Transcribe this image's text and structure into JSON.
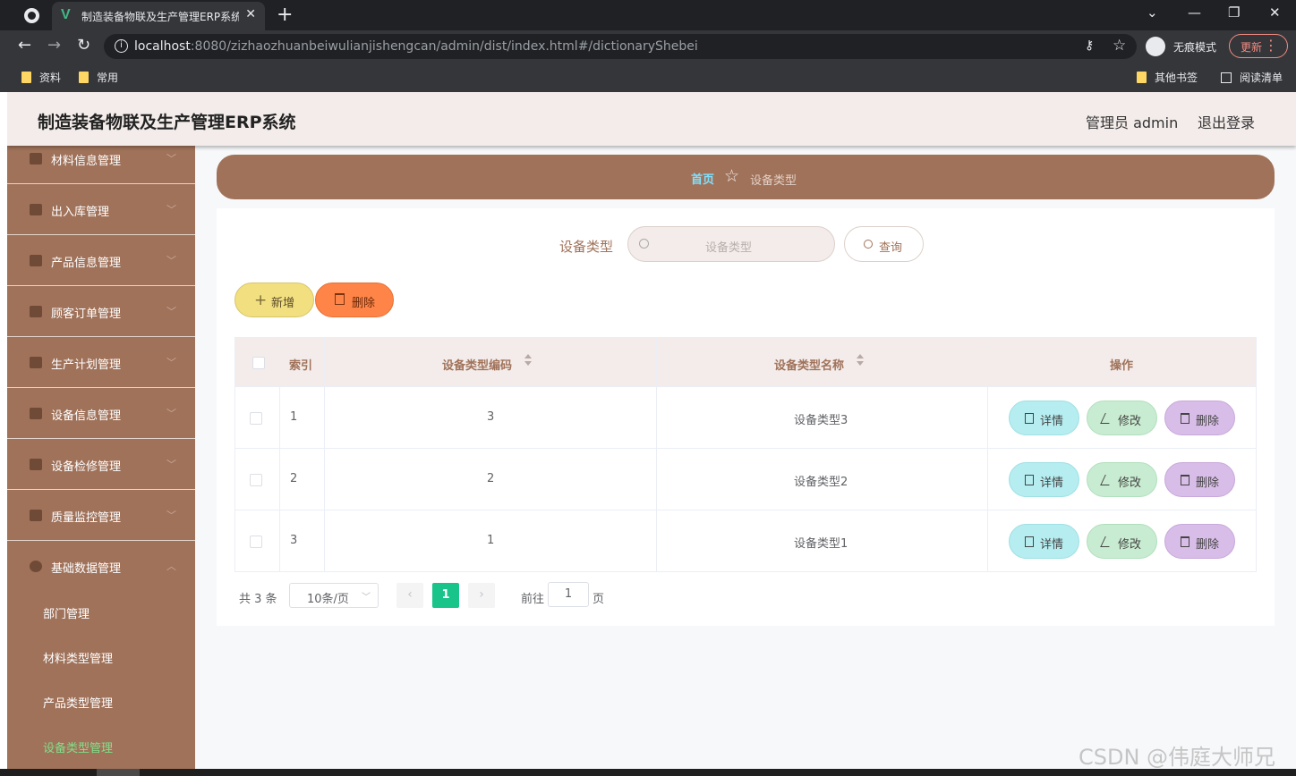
{
  "browser": {
    "tab_title": "制造装备物联及生产管理ERP系统",
    "close_glyph": "✕",
    "new_tab_glyph": "+",
    "url_host": "localhost",
    "url_rest": ":8080/zizhaozhuanbeiwulianjishengcan/admin/dist/index.html#/dictionaryShebei",
    "incognito_label": "无痕模式",
    "update_label": "更新",
    "bookmarks": [
      "资料",
      "常用"
    ],
    "bookmarks_right": [
      "其他书签",
      "阅读清单"
    ]
  },
  "header": {
    "title": "制造装备物联及生产管理ERP系统",
    "user": "管理员 admin",
    "logout": "退出登录"
  },
  "sidebar": {
    "items": [
      {
        "label": "材料信息管理",
        "icon": "ticket-icon"
      },
      {
        "label": "出入库管理",
        "icon": "flag-icon"
      },
      {
        "label": "产品信息管理",
        "icon": "microphone-icon"
      },
      {
        "label": "顾客订单管理",
        "icon": "sliders-icon"
      },
      {
        "label": "生产计划管理",
        "icon": "monitor-icon"
      },
      {
        "label": "设备信息管理",
        "icon": "user-icon"
      },
      {
        "label": "设备检修管理",
        "icon": "brush-icon"
      },
      {
        "label": "质量监控管理",
        "icon": "chart-icon"
      },
      {
        "label": "基础数据管理",
        "icon": "compass-icon"
      }
    ],
    "sub_items": [
      "部门管理",
      "材料类型管理",
      "产品类型管理",
      "设备类型管理"
    ]
  },
  "breadcrumb": {
    "home": "首页",
    "current": "设备类型"
  },
  "search": {
    "label": "设备类型",
    "placeholder": "设备类型",
    "button": "查询"
  },
  "actions": {
    "add": "新增",
    "delete": "删除"
  },
  "table": {
    "headers": {
      "index": "索引",
      "code": "设备类型编码",
      "name": "设备类型名称",
      "ops": "操作"
    },
    "rows": [
      {
        "index": "1",
        "code": "3",
        "name": "设备类型3"
      },
      {
        "index": "2",
        "code": "2",
        "name": "设备类型2"
      },
      {
        "index": "3",
        "code": "1",
        "name": "设备类型1"
      }
    ],
    "row_actions": {
      "detail": "详情",
      "edit": "修改",
      "remove": "删除"
    }
  },
  "pagination": {
    "total": "共 3 条",
    "page_size": "10条/页",
    "current": "1",
    "goto_label": "前往",
    "goto_value": "1",
    "goto_unit": "页"
  },
  "watermark": "CSDN @伟庭大师兄",
  "colors": {
    "sidebar": "#a0725a",
    "header": "#f3ecea",
    "active_sub": "#7fe08a",
    "page_active": "#19c48a"
  }
}
